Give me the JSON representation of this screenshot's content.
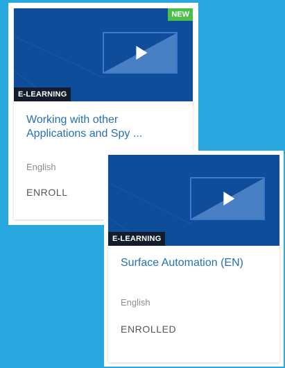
{
  "courses": [
    {
      "type_label": "E-LEARNING",
      "new_badge": "NEW",
      "title_line1": "Working with other",
      "title_line2": "Applications and Spy ...",
      "language": "English",
      "action": "ENROLL"
    },
    {
      "type_label": "E-LEARNING",
      "title": "Surface Automation (EN)",
      "language": "English",
      "action": "ENROLLED"
    }
  ],
  "colors": {
    "background": "#29a8e0",
    "thumbnail": "#0f4d9a",
    "title_link": "#2470b3",
    "new_badge": "#4cbf4a",
    "type_badge": "#121c2b"
  },
  "icons": {
    "thumbnail_icon": "play-icon"
  }
}
